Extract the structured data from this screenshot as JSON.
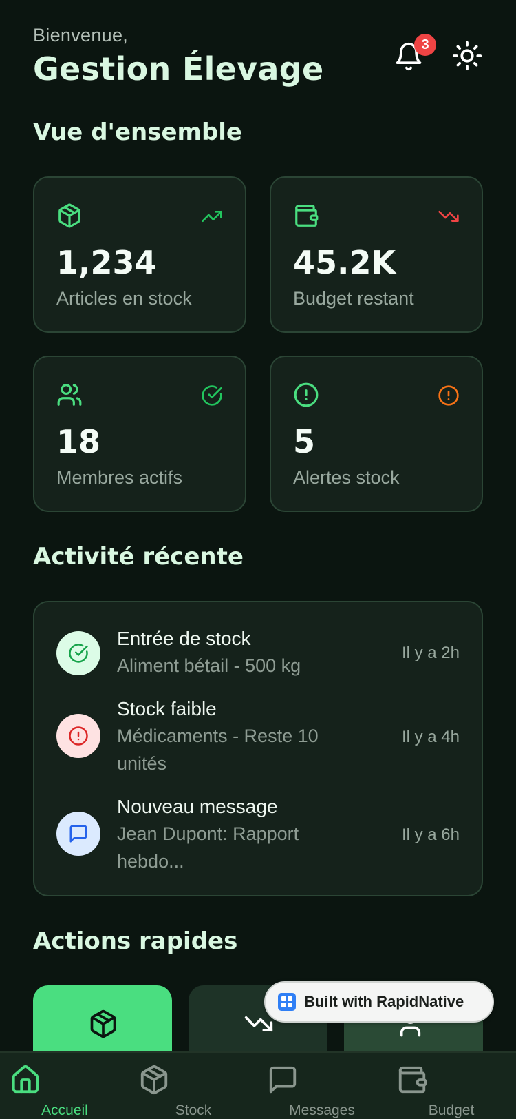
{
  "header": {
    "greeting": "Bienvenue,",
    "title": "Gestion Élevage",
    "notification_count": "3"
  },
  "overview": {
    "title": "Vue d'ensemble",
    "cards": [
      {
        "value": "1,234",
        "label": "Articles en stock",
        "icon": "package-icon",
        "trend": "trending-up-icon"
      },
      {
        "value": "45.2K",
        "label": "Budget restant",
        "icon": "wallet-icon",
        "trend": "trending-down-icon"
      },
      {
        "value": "18",
        "label": "Membres actifs",
        "icon": "users-icon",
        "trend": "check-circle-icon"
      },
      {
        "value": "5",
        "label": "Alertes stock",
        "icon": "alert-circle-icon",
        "trend": "alert-circle-icon"
      }
    ]
  },
  "activity": {
    "title": "Activité récente",
    "items": [
      {
        "title": "Entrée de stock",
        "desc": "Aliment bétail - 500 kg",
        "time": "Il y a 2h",
        "icon": "check-circle-icon"
      },
      {
        "title": "Stock faible",
        "desc": "Médicaments - Reste 10 unités",
        "time": "Il y a 4h",
        "icon": "alert-circle-icon"
      },
      {
        "title": "Nouveau message",
        "desc": "Jean Dupont: Rapport hebdo...",
        "time": "Il y a 6h",
        "icon": "message-icon"
      }
    ]
  },
  "quick_actions": {
    "title": "Actions rapides"
  },
  "watermark": {
    "label": "Built with RapidNative"
  },
  "nav": {
    "items": [
      {
        "label": "Accueil",
        "icon": "home-icon",
        "active": true
      },
      {
        "label": "Stock",
        "icon": "package-icon",
        "active": false
      },
      {
        "label": "Messages",
        "icon": "message-icon",
        "active": false
      },
      {
        "label": "Budget",
        "icon": "wallet-icon",
        "active": false
      }
    ]
  },
  "colors": {
    "background": "#0b1510",
    "card": "#15221b",
    "accent_green": "#4ade80",
    "danger": "#ef4444",
    "warning": "#f97316"
  }
}
